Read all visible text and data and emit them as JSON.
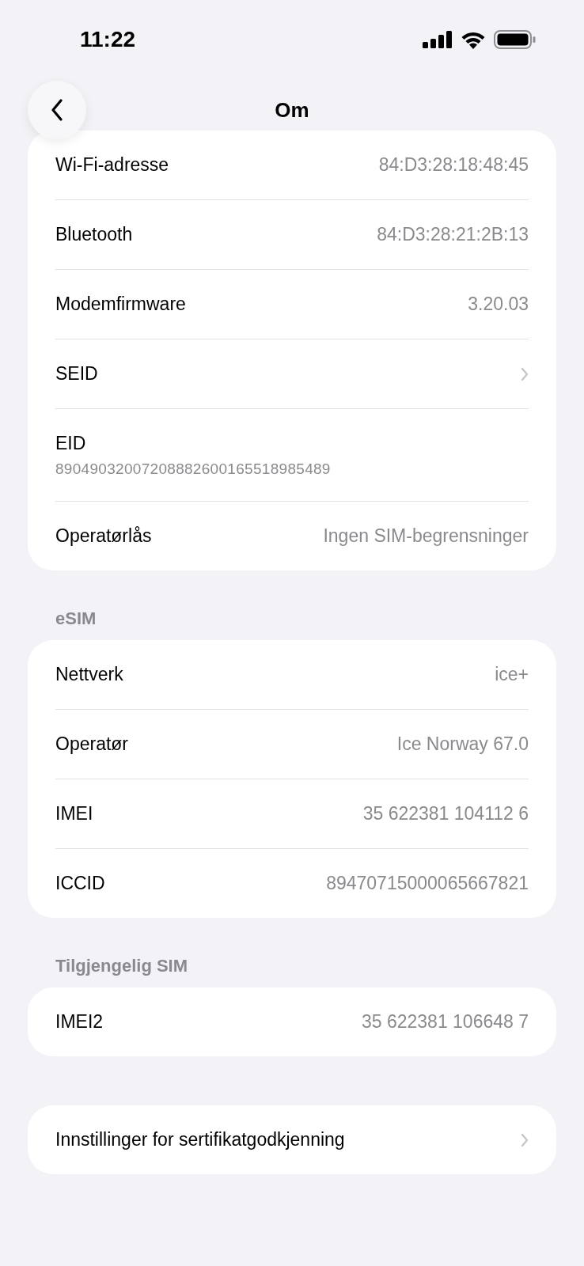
{
  "status_bar": {
    "time": "11:22"
  },
  "nav": {
    "title": "Om"
  },
  "sections": [
    {
      "rows": [
        {
          "kind": "value",
          "label": "Wi-Fi-adresse",
          "value": "84:D3:28:18:48:45"
        },
        {
          "kind": "value",
          "label": "Bluetooth",
          "value": "84:D3:28:21:2B:13"
        },
        {
          "kind": "value",
          "label": "Modemfirmware",
          "value": "3.20.03"
        },
        {
          "kind": "link",
          "label": "SEID"
        },
        {
          "kind": "stacked",
          "label": "EID",
          "value": "89049032007208882600165518985489"
        },
        {
          "kind": "value",
          "label": "Operatørlås",
          "value": "Ingen SIM-begrensninger"
        }
      ]
    },
    {
      "header": "eSIM",
      "rows": [
        {
          "kind": "value",
          "label": "Nettverk",
          "value": "ice+"
        },
        {
          "kind": "value",
          "label": "Operatør",
          "value": "Ice Norway 67.0"
        },
        {
          "kind": "value",
          "label": "IMEI",
          "value": "35 622381 104112 6"
        },
        {
          "kind": "value",
          "label": "ICCID",
          "value": "89470715000065667821"
        }
      ]
    },
    {
      "header": "Tilgjengelig SIM",
      "rows": [
        {
          "kind": "value",
          "label": "IMEI2",
          "value": "35 622381 106648 7"
        }
      ]
    },
    {
      "rows": [
        {
          "kind": "link",
          "label": "Innstillinger for sertifikatgodkjenning"
        }
      ]
    }
  ]
}
